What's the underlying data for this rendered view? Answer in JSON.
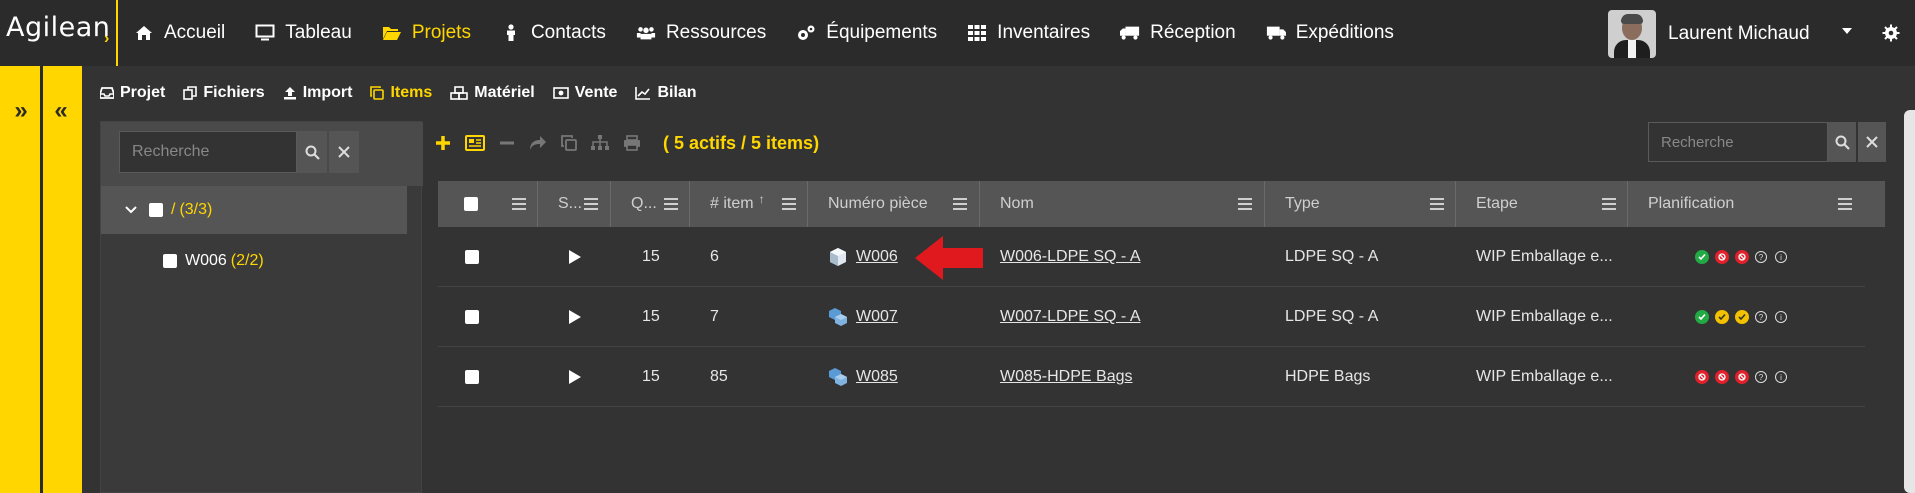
{
  "brand": {
    "logo_text": "Agilean",
    "accent_color": "#ffd600"
  },
  "nav": [
    {
      "label": "Accueil",
      "icon": "home-icon",
      "active": false
    },
    {
      "label": "Tableau",
      "icon": "monitor-icon",
      "active": false
    },
    {
      "label": "Projets",
      "icon": "folder-open-icon",
      "active": true
    },
    {
      "label": "Contacts",
      "icon": "person-icon",
      "active": false
    },
    {
      "label": "Ressources",
      "icon": "users-icon",
      "active": false
    },
    {
      "label": "Équipements",
      "icon": "cogs-icon",
      "active": false
    },
    {
      "label": "Inventaires",
      "icon": "grid-icon",
      "active": false
    },
    {
      "label": "Réception",
      "icon": "truck-icon",
      "active": false
    },
    {
      "label": "Expéditions",
      "icon": "shipping-truck-icon",
      "active": false
    }
  ],
  "user": {
    "name": "Laurent Michaud"
  },
  "subnav": [
    {
      "label": "Projet",
      "icon": "inbox-icon",
      "active": false
    },
    {
      "label": "Fichiers",
      "icon": "files-icon",
      "active": false
    },
    {
      "label": "Import",
      "icon": "upload-icon",
      "active": false
    },
    {
      "label": "Items",
      "icon": "copy-icon",
      "active": true
    },
    {
      "label": "Matériel",
      "icon": "cubes-icon",
      "active": false
    },
    {
      "label": "Vente",
      "icon": "money-icon",
      "active": false
    },
    {
      "label": "Bilan",
      "icon": "line-chart-icon",
      "active": false
    }
  ],
  "tree": {
    "search_placeholder": "Recherche",
    "root": {
      "label": "/",
      "count": "(3/3)"
    },
    "children": [
      {
        "label": "W006",
        "count": "(2/2)"
      }
    ]
  },
  "toolbar": {
    "summary": "( 5 actifs / 5 items)"
  },
  "grid": {
    "search_placeholder": "Recherche",
    "columns": [
      "S...",
      "Q...",
      "# item",
      "Numéro pièce",
      "Nom",
      "Type",
      "Etape",
      "Planification"
    ],
    "sort_indicator": "↑",
    "rows": [
      {
        "qty": "15",
        "item": "6",
        "part": "W006",
        "name": "W006-LDPE SQ - A",
        "type": "LDPE SQ - A",
        "stage": "WIP Emballage e...",
        "plan": [
          "green",
          "red",
          "red"
        ]
      },
      {
        "qty": "15",
        "item": "7",
        "part": "W007",
        "name": "W007-LDPE SQ - A",
        "type": "LDPE SQ - A",
        "stage": "WIP Emballage e...",
        "plan": [
          "green",
          "yellow",
          "yellow"
        ]
      },
      {
        "qty": "15",
        "item": "85",
        "part": "W085",
        "name": "W085-HDPE Bags",
        "type": "HDPE Bags",
        "stage": "WIP Emballage e...",
        "plan": [
          "red",
          "red",
          "red"
        ]
      }
    ]
  },
  "colors": {
    "green": "#22aa44",
    "red": "#e0202a",
    "yellow": "#f2c200"
  }
}
